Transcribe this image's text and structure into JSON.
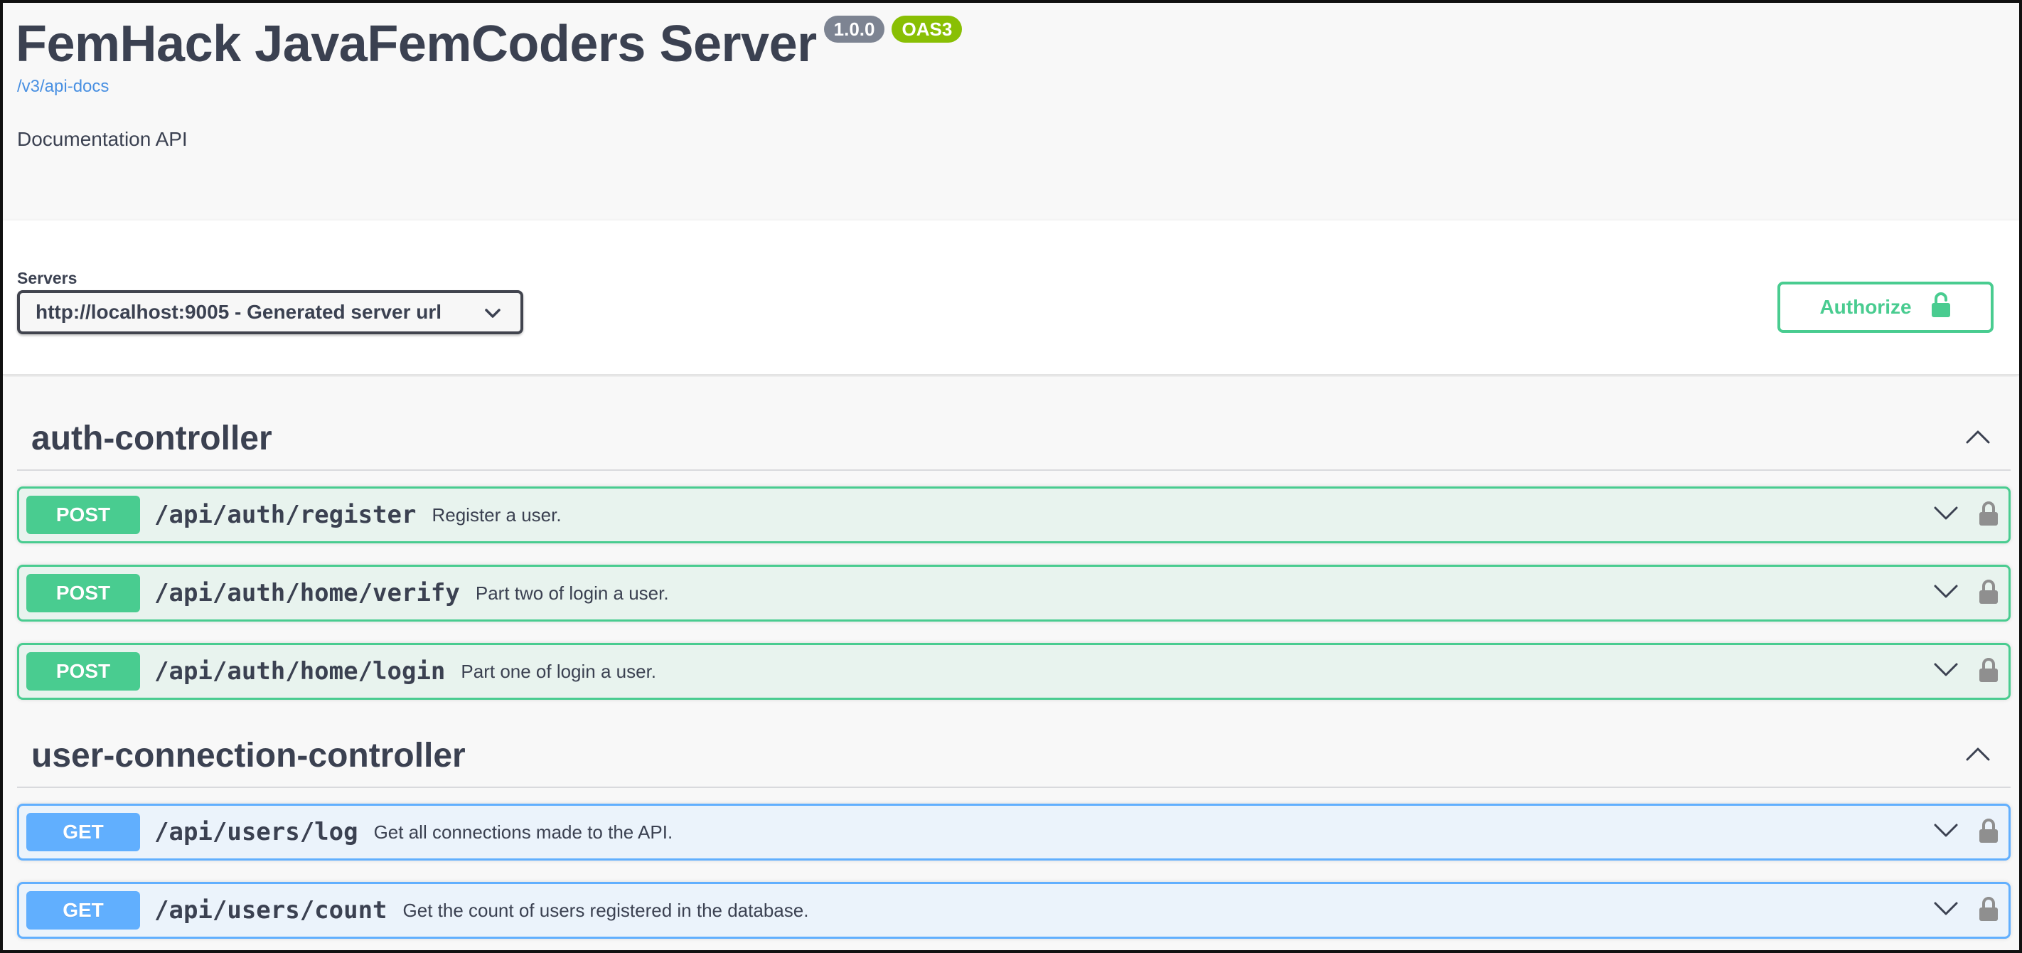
{
  "info": {
    "title": "FemHack JavaFemCoders Server",
    "version": "1.0.0",
    "oas_badge": "OAS3",
    "spec_link": "/v3/api-docs",
    "description": "Documentation API"
  },
  "servers": {
    "label": "Servers",
    "selected": "http://localhost:9005 - Generated server url"
  },
  "authorize": {
    "label": "Authorize"
  },
  "tags": [
    {
      "name": "auth-controller",
      "operations": [
        {
          "method": "POST",
          "path": "/api/auth/register",
          "summary": "Register a user."
        },
        {
          "method": "POST",
          "path": "/api/auth/home/verify",
          "summary": "Part two of login a user."
        },
        {
          "method": "POST",
          "path": "/api/auth/home/login",
          "summary": "Part one of login a user."
        }
      ]
    },
    {
      "name": "user-connection-controller",
      "operations": [
        {
          "method": "GET",
          "path": "/api/users/log",
          "summary": "Get all connections made to the API."
        },
        {
          "method": "GET",
          "path": "/api/users/count",
          "summary": "Get the count of users registered in the database."
        }
      ]
    }
  ],
  "colors": {
    "post": "#49cc90",
    "get": "#61affe",
    "version_badge": "#7d8492",
    "oas_badge": "#89bf04",
    "link": "#4990e2"
  },
  "icons": {
    "select_arrow": "chevron-down-icon",
    "authorize": "lock-open-icon",
    "tag_toggle": "chevron-up-icon",
    "op_toggle": "chevron-down-icon",
    "op_lock": "lock-icon"
  }
}
